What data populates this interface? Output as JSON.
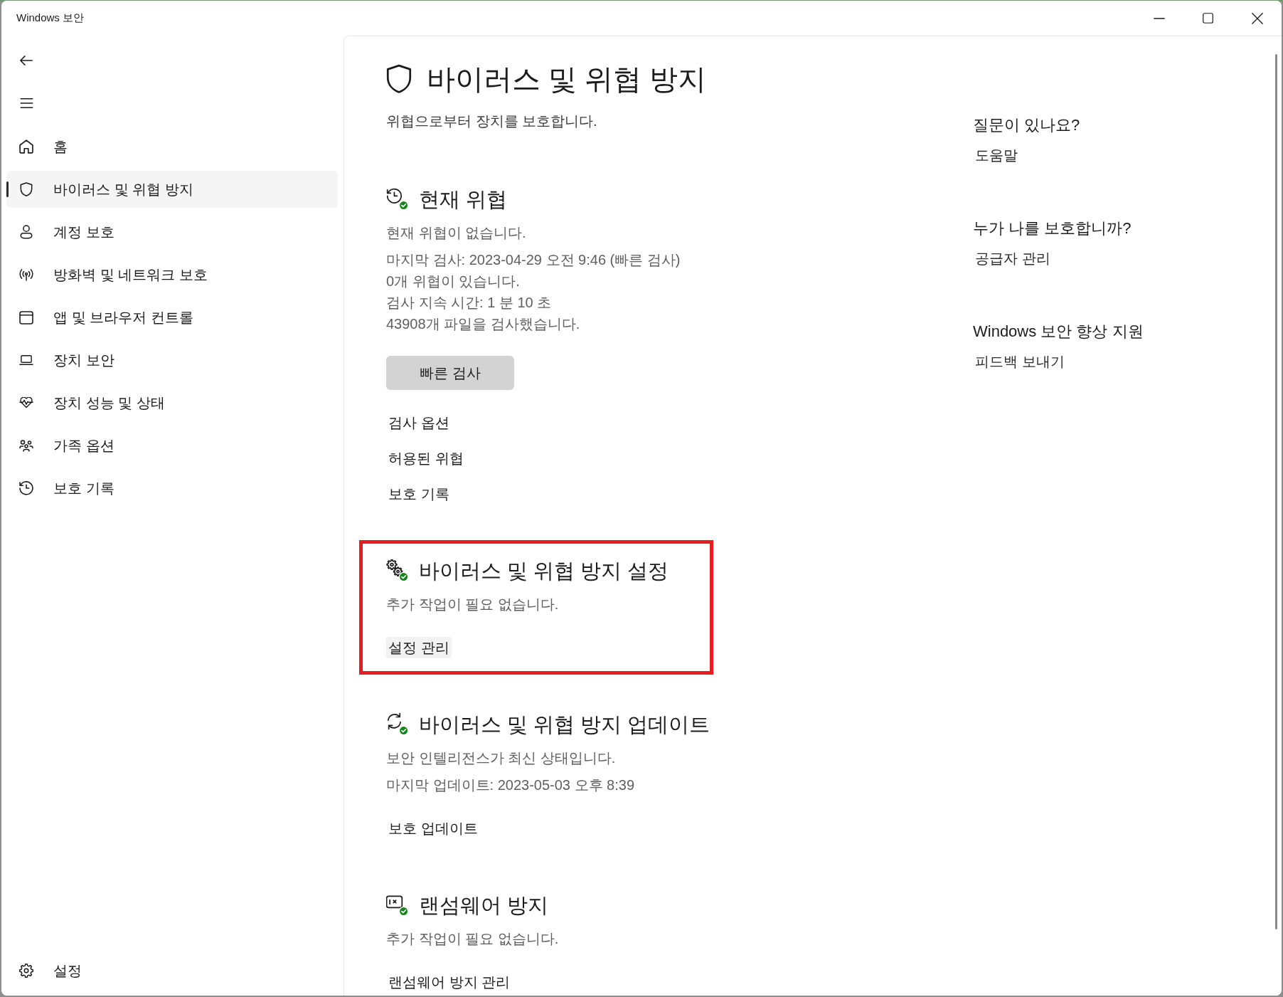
{
  "window": {
    "title": "Windows 보안"
  },
  "sidebar": {
    "items": [
      {
        "label": "홈",
        "selected": false
      },
      {
        "label": "바이러스 및 위협 방지",
        "selected": true
      },
      {
        "label": "계정 보호",
        "selected": false
      },
      {
        "label": "방화벽 및 네트워크 보호",
        "selected": false
      },
      {
        "label": "앱 및 브라우저 컨트롤",
        "selected": false
      },
      {
        "label": "장치 보안",
        "selected": false
      },
      {
        "label": "장치 성능 및 상태",
        "selected": false
      },
      {
        "label": "가족 옵션",
        "selected": false
      },
      {
        "label": "보호 기록",
        "selected": false
      }
    ],
    "footer_items": [
      {
        "label": "설정",
        "selected": false
      }
    ]
  },
  "page": {
    "title": "바이러스 및 위협 방지",
    "subtitle": "위협으로부터 장치를 보호합니다."
  },
  "sections": [
    {
      "title": "현재 위협",
      "protected": true,
      "highlighted": false,
      "summary": "현재 위협이 없습니다.",
      "details": [
        "마지막 검사: 2023-04-29 오전 9:46 (빠른 검사)",
        "0개 위협이 있습니다.",
        "검사 지속 시간: 1 분 10 초",
        "43908개 파일을 검사했습니다."
      ],
      "button": "빠른 검사",
      "links": [
        {
          "label": "검사 옵션",
          "hovered": false
        },
        {
          "label": "허용된 위협",
          "hovered": false
        },
        {
          "label": "보호 기록",
          "hovered": false
        }
      ]
    },
    {
      "title": "바이러스 및 위협 방지 설정",
      "protected": true,
      "highlighted": true,
      "summary": "추가 작업이 필요 없습니다.",
      "links": [
        {
          "label": "설정 관리",
          "hovered": true
        }
      ]
    },
    {
      "title": "바이러스 및 위협 방지 업데이트",
      "protected": true,
      "highlighted": false,
      "summary": "보안 인텔리전스가 최신 상태입니다.",
      "details": [
        "마지막 업데이트: 2023-05-03 오후 8:39"
      ],
      "links": [
        {
          "label": "보호 업데이트",
          "hovered": false
        }
      ]
    },
    {
      "title": "랜섬웨어 방지",
      "protected": true,
      "highlighted": false,
      "summary": "추가 작업이 필요 없습니다.",
      "links": [
        {
          "label": "랜섬웨어 방지 관리",
          "hovered": false
        }
      ]
    }
  ],
  "help": [
    {
      "heading": "질문이 있나요?",
      "link": "도움말"
    },
    {
      "heading": "누가 나를 보호합니까?",
      "link": "공급자 관리"
    },
    {
      "heading": "Windows 보안 향상 지원",
      "link": "피드백 보내기"
    }
  ]
}
